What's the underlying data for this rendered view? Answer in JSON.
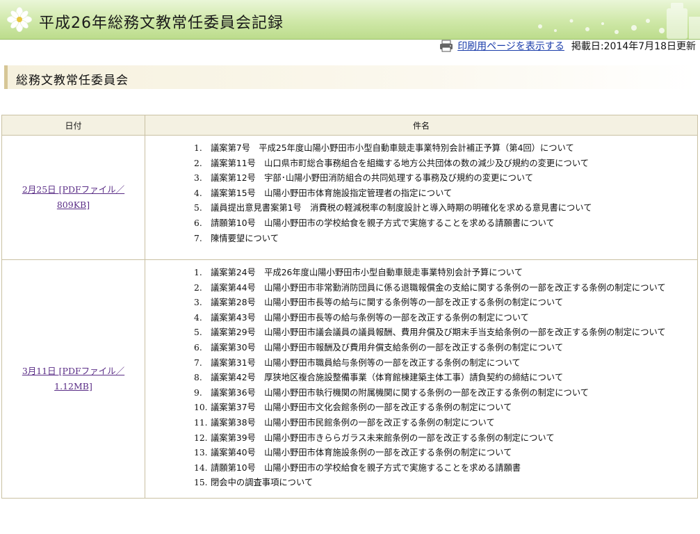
{
  "header": {
    "title": "平成26年総務文教常任委員会記録",
    "brand_color": "#bcdc8c"
  },
  "toolbar": {
    "print_link": "印刷用ページを表示する",
    "updated": "掲載日:2014年7月18日更新"
  },
  "section": {
    "title": "総務文教常任委員会"
  },
  "table": {
    "columns": [
      "日付",
      "件名"
    ],
    "rows": [
      {
        "date_link": "2月25日 [PDFファイル／809KB]",
        "items": [
          "議案第7号　平成25年度山陽小野田市小型自動車競走事業特別会計補正予算（第4回）について",
          "議案第11号　山口県市町総合事務組合を組織する地方公共団体の数の減少及び規約の変更について",
          "議案第12号　宇部･山陽小野田消防組合の共同処理する事務及び規約の変更について",
          "議案第15号　山陽小野田市体育施設指定管理者の指定について",
          "議員提出意見書案第1号　消費税の軽減税率の制度設計と導入時期の明確化を求める意見書について",
          "請願第10号　山陽小野田市の学校給食を親子方式で実施することを求める請願書について",
          "陳情要望について"
        ]
      },
      {
        "date_link": "3月11日 [PDFファイル／1.12MB]",
        "items": [
          "議案第24号　平成26年度山陽小野田市小型自動車競走事業特別会計予算について",
          "議案第44号　山陽小野田市非常勤消防団員に係る退職報償金の支給に関する条例の一部を改正する条例の制定について",
          "議案第28号　山陽小野田市長等の給与に関する条例等の一部を改正する条例の制定について",
          "議案第43号　山陽小野田市長等の給与条例等の一部を改正する条例の制定について",
          "議案第29号　山陽小野田市議会議員の議員報酬、費用弁償及び期末手当支給条例の一部を改正する条例の制定について",
          "議案第30号　山陽小野田市報酬及び費用弁償支給条例の一部を改正する条例の制定について",
          "議案第31号　山陽小野田市職員給与条例等の一部を改正する条例の制定について",
          "議案第42号　厚狭地区複合施設整備事業（体育館棟建築主体工事）請負契約の締結について",
          "議案第36号　山陽小野田市執行機関の附属機関に関する条例の一部を改正する条例の制定について",
          "議案第37号　山陽小野田市文化会館条例の一部を改正する条例の制定について",
          "議案第38号　山陽小野田市民館条例の一部を改正する条例の制定について",
          "議案第39号　山陽小野田市きららガラス未来館条例の一部を改正する条例の制定について",
          "議案第40号　山陽小野田市体育施設条例の一部を改正する条例の制定について",
          "請願第10号　山陽小野田市の学校給食を親子方式で実施することを求める請願書",
          "閉会中の調査事項について"
        ]
      }
    ]
  },
  "icons": {
    "logo": "flower-logo-icon",
    "printer": "printer-icon"
  }
}
